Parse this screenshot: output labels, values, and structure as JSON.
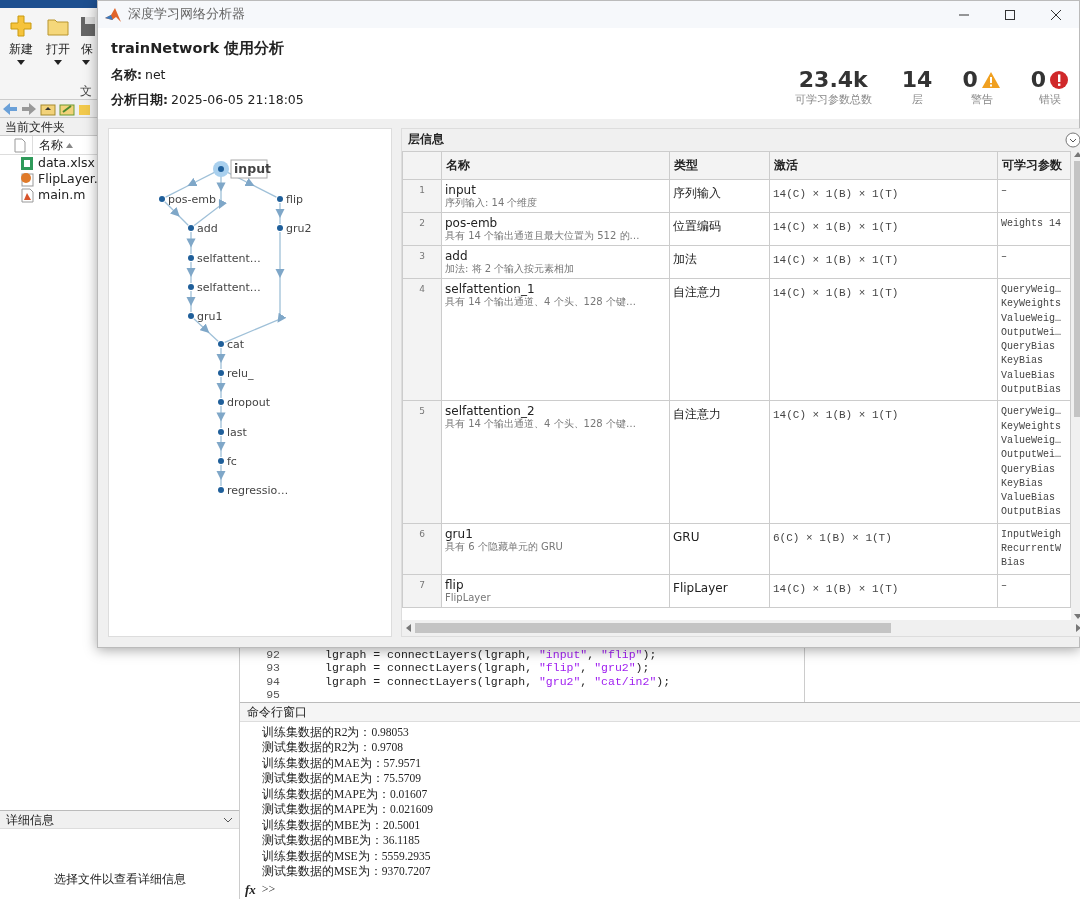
{
  "matlab": {
    "toolstrip": {
      "buttons": [
        {
          "label": "新建",
          "kind": "new"
        },
        {
          "label": "打开",
          "kind": "open"
        },
        {
          "label": "保",
          "kind": "save"
        }
      ],
      "section": "文"
    },
    "current_folder": {
      "title": "当前文件夹",
      "column": "名称",
      "files": [
        {
          "name": "data.xlsx",
          "kind": "spreadsheet"
        },
        {
          "name": "FlipLayer.",
          "kind": "class"
        },
        {
          "name": "main.m",
          "kind": "script"
        }
      ]
    },
    "details": {
      "title": "详细信息",
      "message": "选择文件以查看详细信息"
    },
    "editor": {
      "lines": [
        {
          "number": "92",
          "code": "lgraph = connectLayers(lgraph, \"input\", \"flip\");"
        },
        {
          "number": "93",
          "code": "lgraph = connectLayers(lgraph, \"flip\", \"gru2\");"
        },
        {
          "number": "94",
          "code": "lgraph = connectLayers(lgraph, \"gru2\", \"cat/in2\");"
        },
        {
          "number": "95"
        }
      ]
    },
    "command_window": {
      "title": "命令行窗口",
      "output": [
        "训练集数据的R2为：0.98053",
        "测试集数据的R2为：0.9708",
        "训练集数据的MAE为：57.9571",
        "测试集数据的MAE为：75.5709",
        "训练集数据的MAPE为：0.01607",
        "测试集数据的MAPE为：0.021609",
        "训练集数据的MBE为：20.5001",
        "测试集数据的MBE为：36.1185",
        "训练集数据的MSE为：5559.2935",
        "测试集数据的MSE为：9370.7207"
      ],
      "fx": "fx",
      "prompt": ">>"
    }
  },
  "analyzer": {
    "title": "深度学习网络分析器",
    "heading": "trainNetwork 使用分析",
    "name_label": "名称:",
    "name": "net",
    "date_label": "分析日期:",
    "date": "2025-06-05 21:18:05",
    "stats": [
      {
        "value": "23.4k",
        "label": "可学习参数总数",
        "kind": "plain"
      },
      {
        "value": "14",
        "label": "层",
        "kind": "plain"
      },
      {
        "value": "0",
        "label": "警告",
        "kind": "warning"
      },
      {
        "value": "0",
        "label": "错误",
        "kind": "error"
      }
    ],
    "graph": {
      "nodes": [
        {
          "label": "input",
          "selected": true
        },
        {
          "label": "pos-emb",
          "selected": false
        },
        {
          "label": "flip",
          "selected": false
        },
        {
          "label": "add",
          "selected": false
        },
        {
          "label": "gru2",
          "selected": false
        },
        {
          "label": "selfattent…",
          "selected": false
        },
        {
          "label": "selfattent…",
          "selected": false
        },
        {
          "label": "gru1",
          "selected": false
        },
        {
          "label": "cat",
          "selected": false
        },
        {
          "label": "relu_",
          "selected": false
        },
        {
          "label": "dropout",
          "selected": false
        },
        {
          "label": "last",
          "selected": false
        },
        {
          "label": "fc",
          "selected": false
        },
        {
          "label": "regressio…",
          "selected": false
        }
      ]
    },
    "layer_info": {
      "title": "层信息",
      "columns": [
        "名称",
        "类型",
        "激活",
        "可学习参数"
      ],
      "rows": [
        {
          "index": "1",
          "name": "input",
          "description": "序列输入: 14 个维度",
          "type": "序列输入",
          "activations": "14(C) × 1(B) × 1(T)",
          "learnables": [
            "–"
          ]
        },
        {
          "index": "2",
          "name": "pos-emb",
          "description": "具有 14 个输出通道且最大位置为 512 的…",
          "type": "位置编码",
          "activations": "14(C) × 1(B) × 1(T)",
          "learnables": [
            "Weights  14"
          ]
        },
        {
          "index": "3",
          "name": "add",
          "description": "加法: 将 2 个输入按元素相加",
          "type": "加法",
          "activations": "14(C) × 1(B) × 1(T)",
          "learnables": [
            "–"
          ]
        },
        {
          "index": "4",
          "name": "selfattention_1",
          "description": "具有 14 个输出通道、4 个头、128 个键…",
          "type": "自注意力",
          "activations": "14(C) × 1(B) × 1(T)",
          "learnables": [
            "QueryWeig…",
            "KeyWeights",
            "ValueWeig…",
            "OutputWei…",
            "QueryBias",
            "KeyBias",
            "ValueBias",
            "OutputBias"
          ]
        },
        {
          "index": "5",
          "name": "selfattention_2",
          "description": "具有 14 个输出通道、4 个头、128 个键…",
          "type": "自注意力",
          "activations": "14(C) × 1(B) × 1(T)",
          "learnables": [
            "QueryWeig…",
            "KeyWeights",
            "ValueWeig…",
            "OutputWei…",
            "QueryBias",
            "KeyBias",
            "ValueBias",
            "OutputBias"
          ]
        },
        {
          "index": "6",
          "name": "gru1",
          "description": "具有 6 个隐藏单元的 GRU",
          "type": "GRU",
          "activations": "6(C) × 1(B) × 1(T)",
          "learnables": [
            "InputWeigh",
            "RecurrentW",
            "Bias"
          ]
        },
        {
          "index": "7",
          "name": "flip",
          "description": "FlipLayer",
          "type": "FlipLayer",
          "activations": "14(C) × 1(B) × 1(T)",
          "learnables": [
            "–"
          ]
        }
      ]
    }
  }
}
